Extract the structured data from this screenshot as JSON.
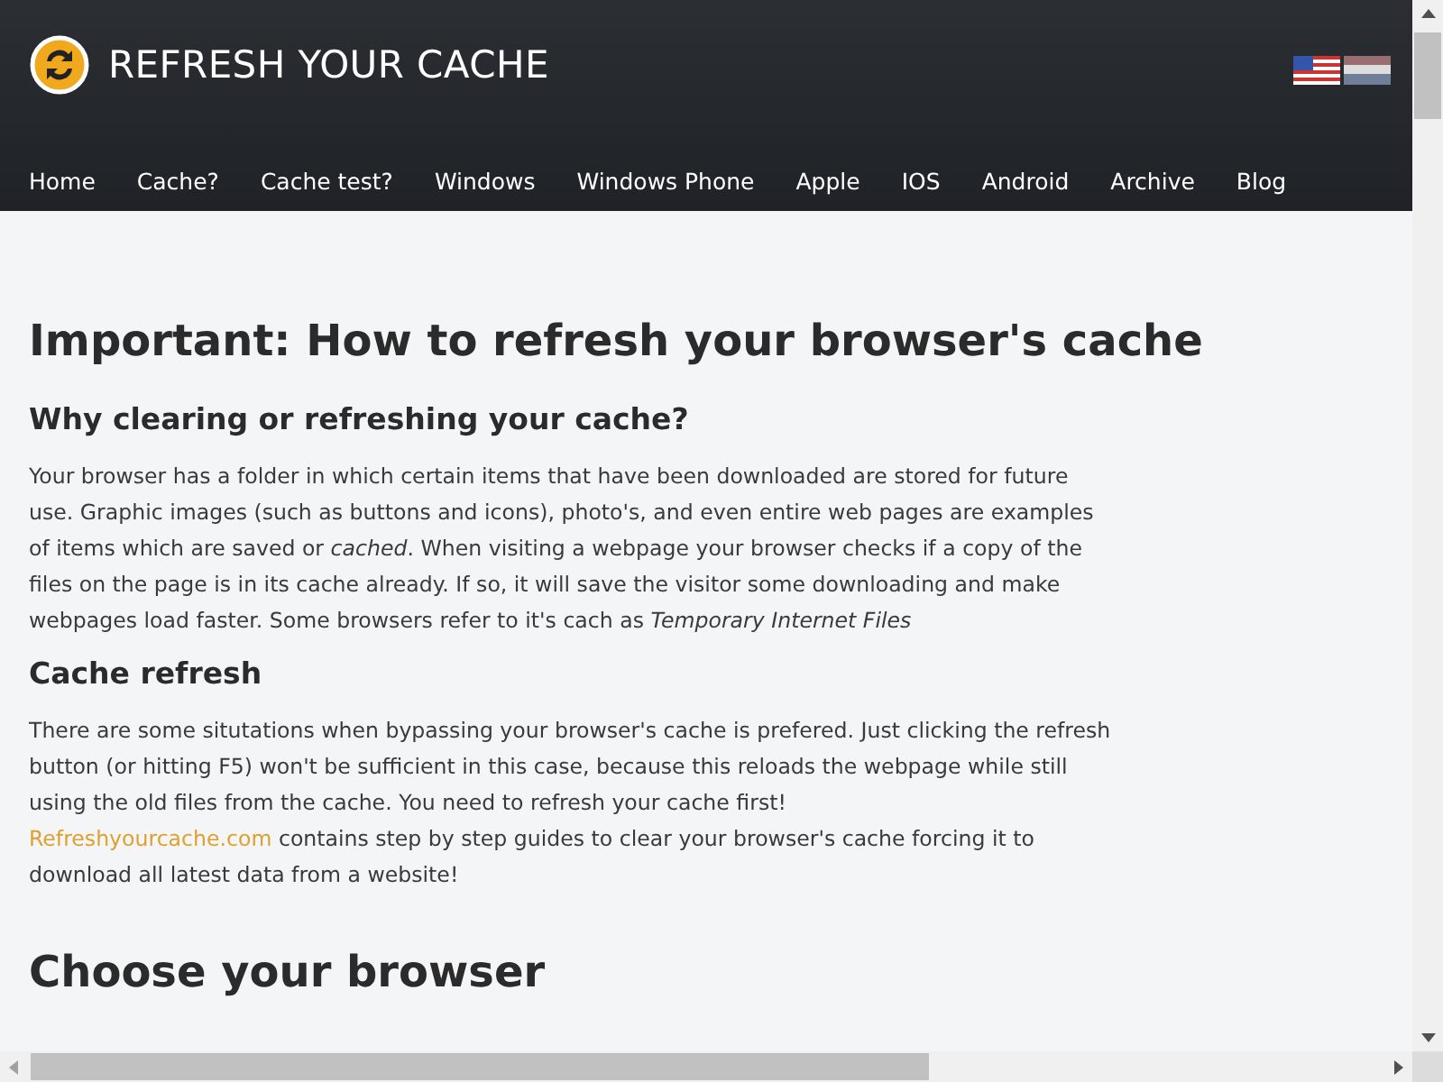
{
  "site": {
    "title": "REFRESH YOUR CACHE"
  },
  "nav": [
    {
      "label": "Home"
    },
    {
      "label": "Cache?"
    },
    {
      "label": "Cache test?"
    },
    {
      "label": "Windows"
    },
    {
      "label": "Windows Phone"
    },
    {
      "label": "Apple"
    },
    {
      "label": "IOS"
    },
    {
      "label": "Android"
    },
    {
      "label": "Archive"
    },
    {
      "label": "Blog"
    }
  ],
  "content": [
    {
      "kind": "h1",
      "text": "Important: How to refresh your browser's cache"
    },
    {
      "kind": "h2",
      "text": "Why clearing or refreshing your cache?"
    },
    {
      "kind": "p",
      "parts": [
        {
          "kind": "text",
          "text": "Your browser has a folder in which certain items that have been downloaded are stored for future use. Graphic images (such as buttons and icons), photo's, and even entire web pages are examples of items which are saved or *cached*. When visiting a webpage your browser checks if a copy of the files on the page is in its cache already. If so, it will save the visitor some downloading and make webpages load faster. Some browsers refer to it's cach as *Temporary Internet Files*"
        }
      ]
    },
    {
      "kind": "h2",
      "text": "Cache refresh"
    },
    {
      "kind": "p",
      "parts": [
        {
          "kind": "text",
          "text": "There are some situtations when bypassing your browser's cache is prefered. Just clicking the refresh button (or hitting F5) won't be sufficient in this case, because this reloads the webpage while still using the old files from the cache. You need to refresh your cache first!"
        },
        {
          "kind": "break"
        },
        {
          "kind": "link",
          "text": "Refreshyourcache.com"
        },
        {
          "kind": "text",
          "text": " contains step by step guides to clear your browser's cache forcing it to download all latest data from a website!"
        }
      ]
    },
    {
      "kind": "h1",
      "text": "Choose your browser"
    }
  ]
}
